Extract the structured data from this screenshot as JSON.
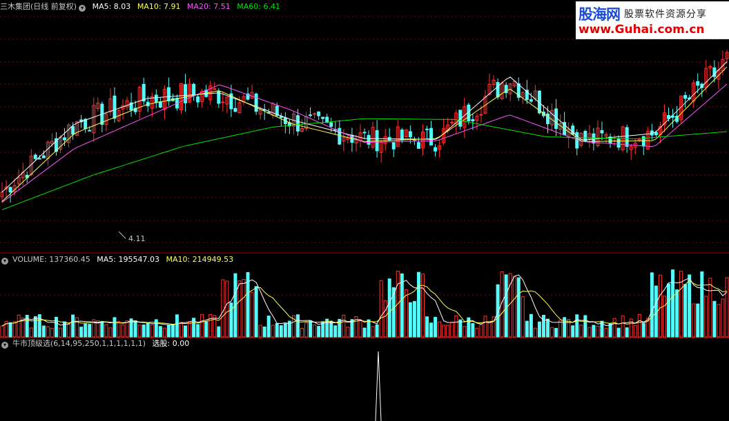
{
  "main_legend": {
    "title": "三木集团(日线 前复权)",
    "ma5": "MA5: 8.03",
    "ma10": "MA10: 7.91",
    "ma20": "MA20: 7.51",
    "ma60": "MA60: 6.41"
  },
  "volume_legend": {
    "title": "VOLUME: 137360.45",
    "ma5": "MA5: 195547.03",
    "ma10": "MA10: 214949.53"
  },
  "indicator_legend": {
    "title": "牛市顶级选(6,14,95,250,1,1,1,1,1,1)",
    "value": "选股: 0.00"
  },
  "price_annotation": "4.11",
  "watermark": {
    "brand": "股海网",
    "slogan": "股票软件资源分享",
    "url": "www.Guhai.com.cn"
  },
  "colors": {
    "up": "#ff3232",
    "down": "#54fcfc",
    "ma5": "#ffffff",
    "ma10": "#ffff54",
    "ma20": "#ff54ff",
    "ma60": "#00e600",
    "grid": "#8b0000"
  },
  "chart_data": [
    {
      "type": "candlestick",
      "title": "三木集团(日线 前复权)",
      "ylim": [
        3.6,
        9.3
      ],
      "series": [
        {
          "name": "MA5",
          "values": [
            5.01,
            6.59,
            7.18,
            7.31,
            6.68,
            6.25,
            6.23,
            7.69,
            6.21,
            6.37,
            8.03
          ]
        },
        {
          "name": "MA10",
          "values": [
            4.79,
            6.37,
            7.04,
            7.36,
            6.59,
            6.18,
            6.25,
            7.41,
            6.18,
            6.2,
            7.91
          ]
        },
        {
          "name": "MA20",
          "values": [
            4.77,
            6.02,
            6.76,
            7.5,
            6.9,
            6.16,
            6.2,
            6.8,
            6.18,
            6.06,
            7.51
          ]
        },
        {
          "name": "MA60",
          "values": [
            4.6,
            5.4,
            6.07,
            6.52,
            6.71,
            6.69,
            6.29,
            6.24,
            6.41
          ]
        }
      ],
      "annotations": [
        {
          "text": "4.11",
          "value": 4.11
        }
      ]
    },
    {
      "type": "bar",
      "title": "VOLUME: 137360.45",
      "series": [
        {
          "name": "MA5",
          "value": 195547.03
        },
        {
          "name": "MA10",
          "value": 214949.53
        }
      ]
    },
    {
      "type": "line",
      "title": "牛市顶级选(6,14,95,250,1,1,1,1,1,1)",
      "series": [
        {
          "name": "选股",
          "value": 0.0
        }
      ]
    }
  ]
}
